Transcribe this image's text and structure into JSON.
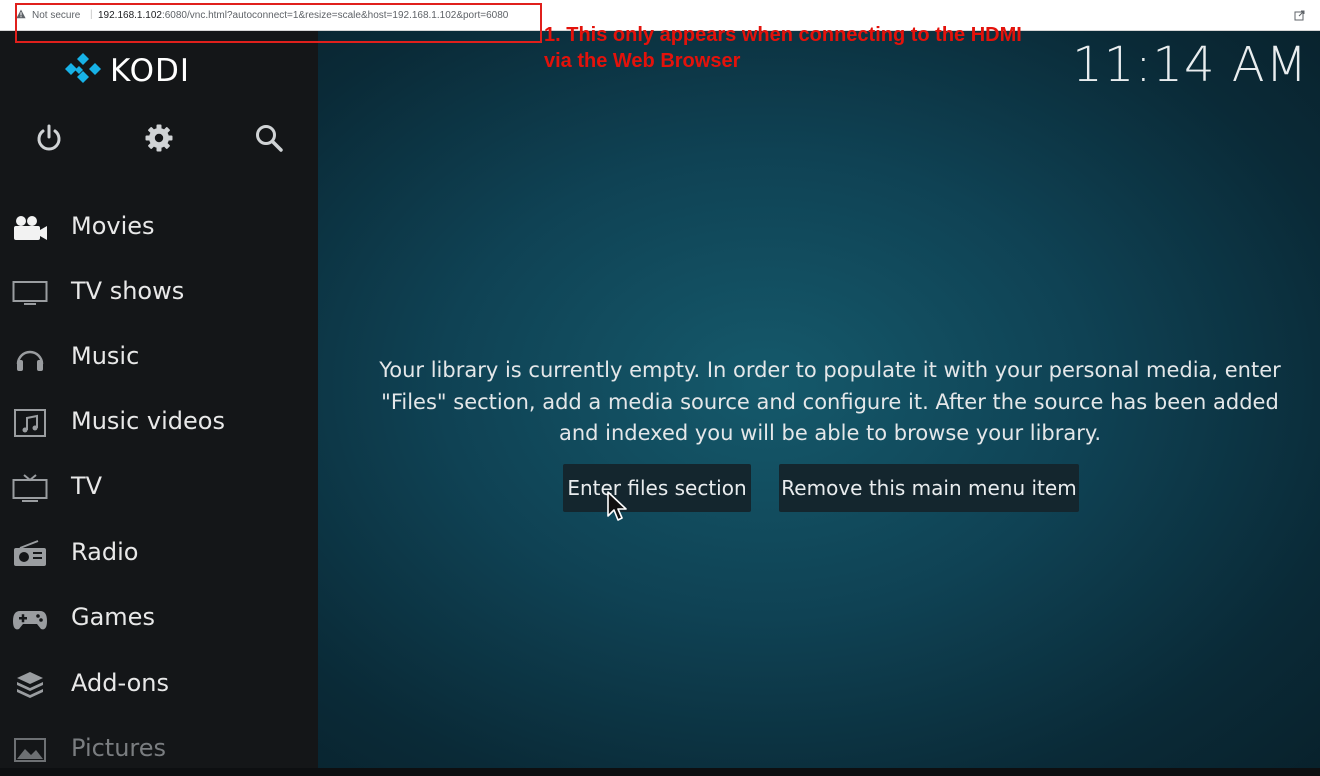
{
  "browser": {
    "security_label": "Not secure",
    "separator": "|",
    "url_host": "192.168.1.102",
    "url_rest": ":6080/vnc.html?autoconnect=1&resize=scale&host=192.168.1.102&port=6080"
  },
  "annotation": {
    "line1": "1. This only appears when connecting to the HDMI",
    "line2": "via the Web Browser",
    "color": "#e3120b"
  },
  "kodi": {
    "logo_text": "KODI",
    "clock": "11:14 AM",
    "top_icons": [
      "power-icon",
      "gear-icon",
      "search-icon"
    ],
    "menu": [
      {
        "label": "Movies",
        "icon": "movie-camera-icon"
      },
      {
        "label": "TV shows",
        "icon": "monitor-icon"
      },
      {
        "label": "Music",
        "icon": "headphones-icon"
      },
      {
        "label": "Music videos",
        "icon": "music-video-icon"
      },
      {
        "label": "TV",
        "icon": "tv-icon"
      },
      {
        "label": "Radio",
        "icon": "radio-icon"
      },
      {
        "label": "Games",
        "icon": "gamepad-icon"
      },
      {
        "label": "Add-ons",
        "icon": "addons-box-icon"
      },
      {
        "label": "Pictures",
        "icon": "pictures-icon"
      }
    ],
    "empty_message": "Your library is currently empty. In order to populate it with your personal media, enter \"Files\" section, add a media source and configure it. After the source has been added and indexed you will be able to browse your library.",
    "buttons": {
      "enter_files": "Enter files section",
      "remove_item": "Remove this main menu item"
    },
    "colors": {
      "sidebar_bg": "#141618",
      "background_center": "#15596b",
      "button_bg": "#14262e",
      "logo_blue": "#17b2e7"
    }
  }
}
